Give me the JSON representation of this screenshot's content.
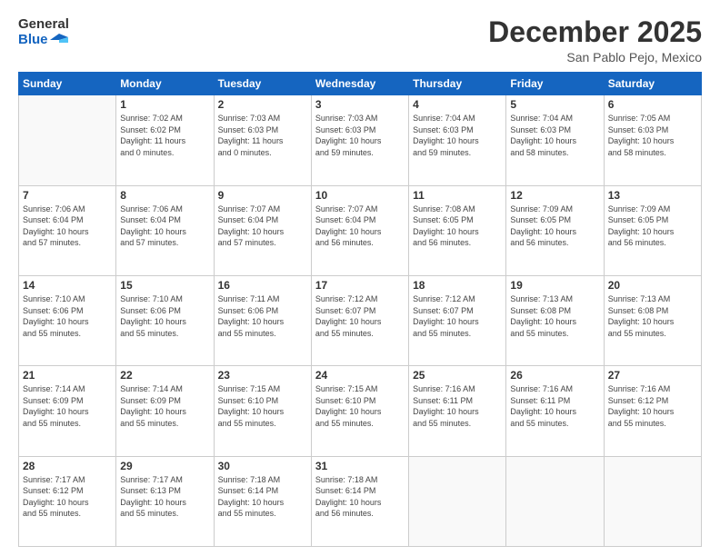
{
  "header": {
    "logo_general": "General",
    "logo_blue": "Blue",
    "month_title": "December 2025",
    "location": "San Pablo Pejo, Mexico"
  },
  "days_of_week": [
    "Sunday",
    "Monday",
    "Tuesday",
    "Wednesday",
    "Thursday",
    "Friday",
    "Saturday"
  ],
  "weeks": [
    [
      {
        "day": "",
        "info": ""
      },
      {
        "day": "1",
        "info": "Sunrise: 7:02 AM\nSunset: 6:02 PM\nDaylight: 11 hours\nand 0 minutes."
      },
      {
        "day": "2",
        "info": "Sunrise: 7:03 AM\nSunset: 6:03 PM\nDaylight: 11 hours\nand 0 minutes."
      },
      {
        "day": "3",
        "info": "Sunrise: 7:03 AM\nSunset: 6:03 PM\nDaylight: 10 hours\nand 59 minutes."
      },
      {
        "day": "4",
        "info": "Sunrise: 7:04 AM\nSunset: 6:03 PM\nDaylight: 10 hours\nand 59 minutes."
      },
      {
        "day": "5",
        "info": "Sunrise: 7:04 AM\nSunset: 6:03 PM\nDaylight: 10 hours\nand 58 minutes."
      },
      {
        "day": "6",
        "info": "Sunrise: 7:05 AM\nSunset: 6:03 PM\nDaylight: 10 hours\nand 58 minutes."
      }
    ],
    [
      {
        "day": "7",
        "info": "Sunrise: 7:06 AM\nSunset: 6:04 PM\nDaylight: 10 hours\nand 57 minutes."
      },
      {
        "day": "8",
        "info": "Sunrise: 7:06 AM\nSunset: 6:04 PM\nDaylight: 10 hours\nand 57 minutes."
      },
      {
        "day": "9",
        "info": "Sunrise: 7:07 AM\nSunset: 6:04 PM\nDaylight: 10 hours\nand 57 minutes."
      },
      {
        "day": "10",
        "info": "Sunrise: 7:07 AM\nSunset: 6:04 PM\nDaylight: 10 hours\nand 56 minutes."
      },
      {
        "day": "11",
        "info": "Sunrise: 7:08 AM\nSunset: 6:05 PM\nDaylight: 10 hours\nand 56 minutes."
      },
      {
        "day": "12",
        "info": "Sunrise: 7:09 AM\nSunset: 6:05 PM\nDaylight: 10 hours\nand 56 minutes."
      },
      {
        "day": "13",
        "info": "Sunrise: 7:09 AM\nSunset: 6:05 PM\nDaylight: 10 hours\nand 56 minutes."
      }
    ],
    [
      {
        "day": "14",
        "info": "Sunrise: 7:10 AM\nSunset: 6:06 PM\nDaylight: 10 hours\nand 55 minutes."
      },
      {
        "day": "15",
        "info": "Sunrise: 7:10 AM\nSunset: 6:06 PM\nDaylight: 10 hours\nand 55 minutes."
      },
      {
        "day": "16",
        "info": "Sunrise: 7:11 AM\nSunset: 6:06 PM\nDaylight: 10 hours\nand 55 minutes."
      },
      {
        "day": "17",
        "info": "Sunrise: 7:12 AM\nSunset: 6:07 PM\nDaylight: 10 hours\nand 55 minutes."
      },
      {
        "day": "18",
        "info": "Sunrise: 7:12 AM\nSunset: 6:07 PM\nDaylight: 10 hours\nand 55 minutes."
      },
      {
        "day": "19",
        "info": "Sunrise: 7:13 AM\nSunset: 6:08 PM\nDaylight: 10 hours\nand 55 minutes."
      },
      {
        "day": "20",
        "info": "Sunrise: 7:13 AM\nSunset: 6:08 PM\nDaylight: 10 hours\nand 55 minutes."
      }
    ],
    [
      {
        "day": "21",
        "info": "Sunrise: 7:14 AM\nSunset: 6:09 PM\nDaylight: 10 hours\nand 55 minutes."
      },
      {
        "day": "22",
        "info": "Sunrise: 7:14 AM\nSunset: 6:09 PM\nDaylight: 10 hours\nand 55 minutes."
      },
      {
        "day": "23",
        "info": "Sunrise: 7:15 AM\nSunset: 6:10 PM\nDaylight: 10 hours\nand 55 minutes."
      },
      {
        "day": "24",
        "info": "Sunrise: 7:15 AM\nSunset: 6:10 PM\nDaylight: 10 hours\nand 55 minutes."
      },
      {
        "day": "25",
        "info": "Sunrise: 7:16 AM\nSunset: 6:11 PM\nDaylight: 10 hours\nand 55 minutes."
      },
      {
        "day": "26",
        "info": "Sunrise: 7:16 AM\nSunset: 6:11 PM\nDaylight: 10 hours\nand 55 minutes."
      },
      {
        "day": "27",
        "info": "Sunrise: 7:16 AM\nSunset: 6:12 PM\nDaylight: 10 hours\nand 55 minutes."
      }
    ],
    [
      {
        "day": "28",
        "info": "Sunrise: 7:17 AM\nSunset: 6:12 PM\nDaylight: 10 hours\nand 55 minutes."
      },
      {
        "day": "29",
        "info": "Sunrise: 7:17 AM\nSunset: 6:13 PM\nDaylight: 10 hours\nand 55 minutes."
      },
      {
        "day": "30",
        "info": "Sunrise: 7:18 AM\nSunset: 6:14 PM\nDaylight: 10 hours\nand 55 minutes."
      },
      {
        "day": "31",
        "info": "Sunrise: 7:18 AM\nSunset: 6:14 PM\nDaylight: 10 hours\nand 56 minutes."
      },
      {
        "day": "",
        "info": ""
      },
      {
        "day": "",
        "info": ""
      },
      {
        "day": "",
        "info": ""
      }
    ]
  ]
}
